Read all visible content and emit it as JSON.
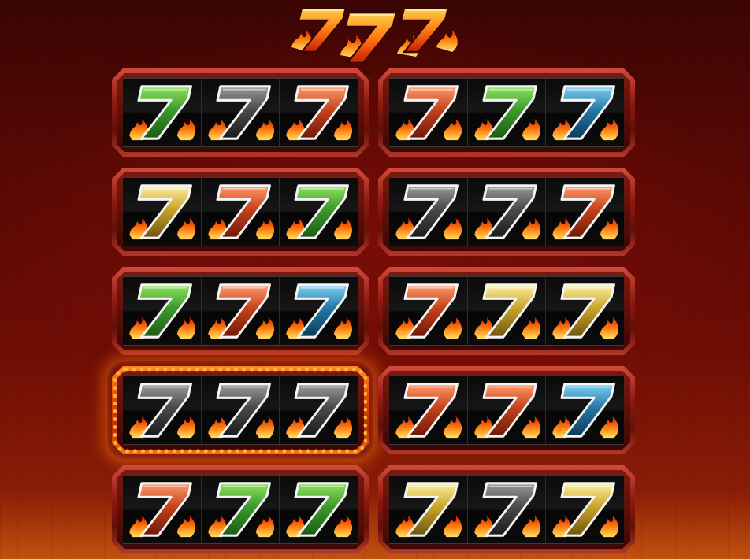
{
  "game": {
    "logo_digits": [
      "7",
      "7",
      "7"
    ],
    "logo_icon": "flaming-triple-seven-logo",
    "selected_machine": 7,
    "colors": {
      "green": "#3c9a2c",
      "grey": "#4a4a4a",
      "red": "#c5421c",
      "blue": "#2478a6",
      "yellow": "#c9a42a",
      "flame": "#ff7a10",
      "frame": "#8c1910",
      "highlight": "#ff8a18"
    },
    "machines": [
      {
        "reels": [
          {
            "symbol": "7",
            "color": "green"
          },
          {
            "symbol": "7",
            "color": "grey"
          },
          {
            "symbol": "7",
            "color": "red"
          }
        ]
      },
      {
        "reels": [
          {
            "symbol": "7",
            "color": "red"
          },
          {
            "symbol": "7",
            "color": "green"
          },
          {
            "symbol": "7",
            "color": "blue"
          }
        ]
      },
      {
        "reels": [
          {
            "symbol": "7",
            "color": "yellow"
          },
          {
            "symbol": "7",
            "color": "red"
          },
          {
            "symbol": "7",
            "color": "green"
          }
        ]
      },
      {
        "reels": [
          {
            "symbol": "7",
            "color": "grey"
          },
          {
            "symbol": "7",
            "color": "grey"
          },
          {
            "symbol": "7",
            "color": "red"
          }
        ]
      },
      {
        "reels": [
          {
            "symbol": "7",
            "color": "green"
          },
          {
            "symbol": "7",
            "color": "red"
          },
          {
            "symbol": "7",
            "color": "blue"
          }
        ]
      },
      {
        "reels": [
          {
            "symbol": "7",
            "color": "red"
          },
          {
            "symbol": "7",
            "color": "yellow"
          },
          {
            "symbol": "7",
            "color": "yellow"
          }
        ]
      },
      {
        "reels": [
          {
            "symbol": "7",
            "color": "grey"
          },
          {
            "symbol": "7",
            "color": "grey"
          },
          {
            "symbol": "7",
            "color": "grey"
          }
        ]
      },
      {
        "reels": [
          {
            "symbol": "7",
            "color": "red"
          },
          {
            "symbol": "7",
            "color": "red"
          },
          {
            "symbol": "7",
            "color": "blue"
          }
        ]
      },
      {
        "reels": [
          {
            "symbol": "7",
            "color": "red"
          },
          {
            "symbol": "7",
            "color": "green"
          },
          {
            "symbol": "7",
            "color": "green"
          }
        ]
      },
      {
        "reels": [
          {
            "symbol": "7",
            "color": "yellow"
          },
          {
            "symbol": "7",
            "color": "grey"
          },
          {
            "symbol": "7",
            "color": "yellow"
          }
        ]
      }
    ]
  }
}
